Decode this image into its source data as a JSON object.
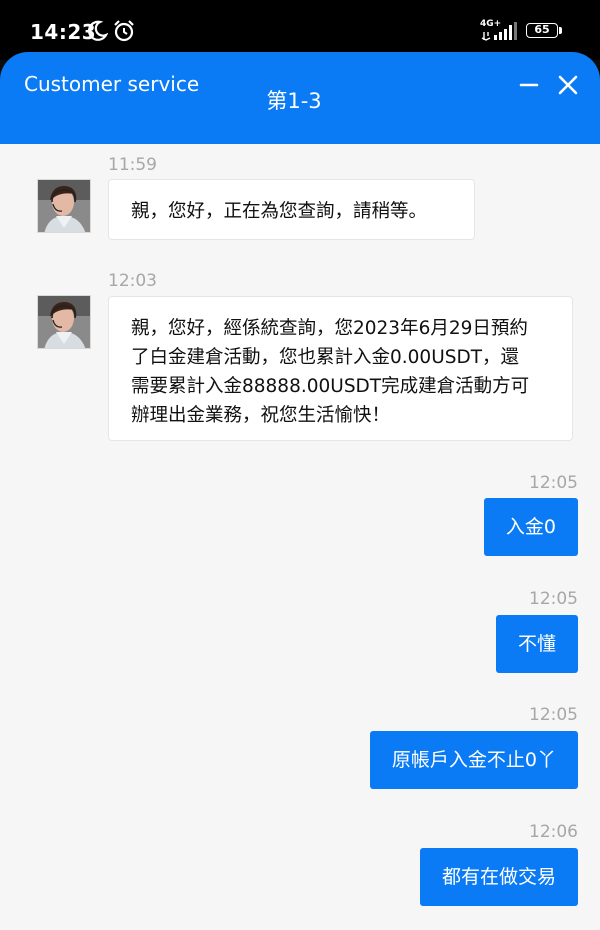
{
  "status_bar": {
    "time": "14:23",
    "network": "4G+",
    "battery": "65",
    "icons": [
      "moon-icon",
      "alarm-icon",
      "signal-icon",
      "battery-icon"
    ]
  },
  "header": {
    "title": "Customer service",
    "subtitle": "第1-3",
    "accent_color": "#0a7bf5",
    "icons": [
      "minimize-icon",
      "close-icon"
    ]
  },
  "messages": [
    {
      "side": "agent",
      "time": "11:59",
      "text": "親，您好，正在為您查詢，請稍等。"
    },
    {
      "side": "agent",
      "time": "12:03",
      "lines": [
        "親，您好，經係統查詢，您2023年6月29日預約",
        "了白金建倉活動，您也累計入金0.00USDT，還",
        "需要累計入金88888.00USDT完成建倉活動方可",
        "辦理出金業務，祝您生活愉快！"
      ]
    },
    {
      "side": "user",
      "time": "12:05",
      "text": "入金0"
    },
    {
      "side": "user",
      "time": "12:05",
      "text": "不懂"
    },
    {
      "side": "user",
      "time": "12:05",
      "text": "原帳戶入金不止0丫"
    },
    {
      "side": "user",
      "time": "12:06",
      "text": "都有在做交易"
    }
  ]
}
